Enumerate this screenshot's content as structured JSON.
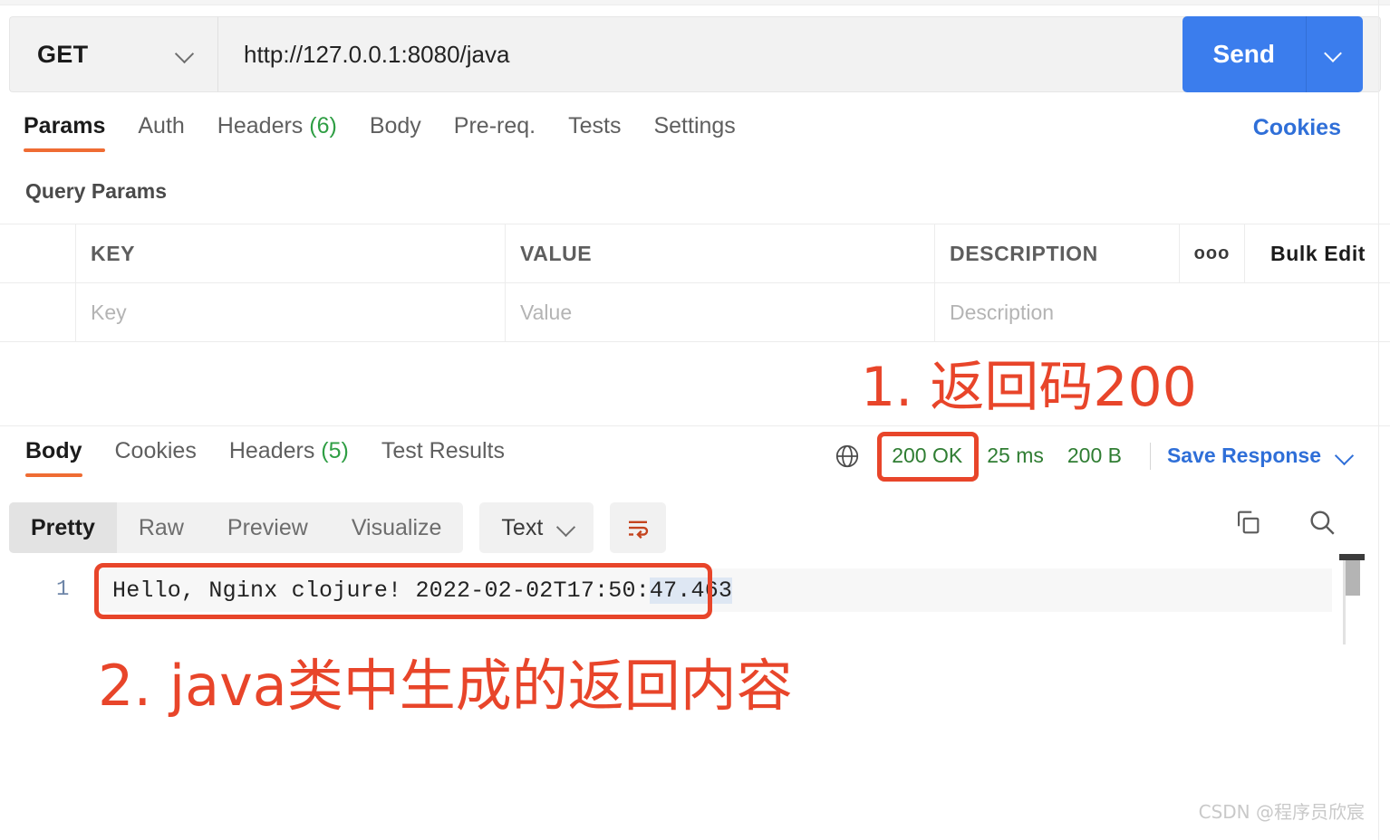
{
  "request": {
    "method": "GET",
    "method_caret_icon": "chevron-down-icon",
    "url": "http://127.0.0.1:8080/java",
    "url_placeholder": "Enter request URL",
    "send_label": "Send",
    "send_caret_icon": "chevron-down-icon",
    "tabs": [
      {
        "label": "Params",
        "count": "",
        "active": true
      },
      {
        "label": "Auth",
        "count": "",
        "active": false
      },
      {
        "label": "Headers",
        "count": "(6)",
        "active": false
      },
      {
        "label": "Body",
        "count": "",
        "active": false
      },
      {
        "label": "Pre-req.",
        "count": "",
        "active": false
      },
      {
        "label": "Tests",
        "count": "",
        "active": false
      },
      {
        "label": "Settings",
        "count": "",
        "active": false
      }
    ],
    "cookies_link": "Cookies"
  },
  "query_params": {
    "title": "Query Params",
    "headers": {
      "key": "KEY",
      "value": "VALUE",
      "description": "DESCRIPTION",
      "more_icon": "ooo",
      "bulk_edit": "Bulk Edit"
    },
    "rows": [
      {
        "key_placeholder": "Key",
        "value_placeholder": "Value",
        "description_placeholder": "Description"
      }
    ]
  },
  "response": {
    "tabs": [
      {
        "label": "Body",
        "count": "",
        "active": true
      },
      {
        "label": "Cookies",
        "count": "",
        "active": false
      },
      {
        "label": "Headers",
        "count": "(5)",
        "active": false
      },
      {
        "label": "Test Results",
        "count": "",
        "active": false
      }
    ],
    "globe_icon": "globe-icon",
    "status": "200 OK",
    "time": "25 ms",
    "size": "200 B",
    "save_response": "Save Response",
    "save_caret_icon": "chevron-down-icon",
    "view_modes": [
      {
        "label": "Pretty",
        "active": true
      },
      {
        "label": "Raw",
        "active": false
      },
      {
        "label": "Preview",
        "active": false
      },
      {
        "label": "Visualize",
        "active": false
      }
    ],
    "content_type": "Text",
    "content_type_caret_icon": "chevron-down-icon",
    "wrap_icon": "wrap-text-icon",
    "copy_icon": "copy-icon",
    "search_icon": "search-icon",
    "body": {
      "line_number": "1",
      "text_plain": "Hello, Nginx clojure! 2022-02-02T17:50:47.463",
      "text_part_1": "Hello, Nginx clojure! 2022-02-02T17:50:",
      "text_part_selected": "47.463"
    }
  },
  "annotations": [
    {
      "id": "ann-1",
      "text": "1. 返回码200",
      "color": "#e8452a"
    },
    {
      "id": "ann-2",
      "text": "2. java类中生成的返回内容",
      "color": "#e8452a"
    }
  ],
  "watermark": "CSDN @程序员欣宸",
  "colors": {
    "accent_orange": "#ef6c33",
    "send_blue": "#3b7ded",
    "link_blue": "#2f6fd8",
    "status_green": "#2f7d32",
    "annotation_red": "#e8452a"
  }
}
